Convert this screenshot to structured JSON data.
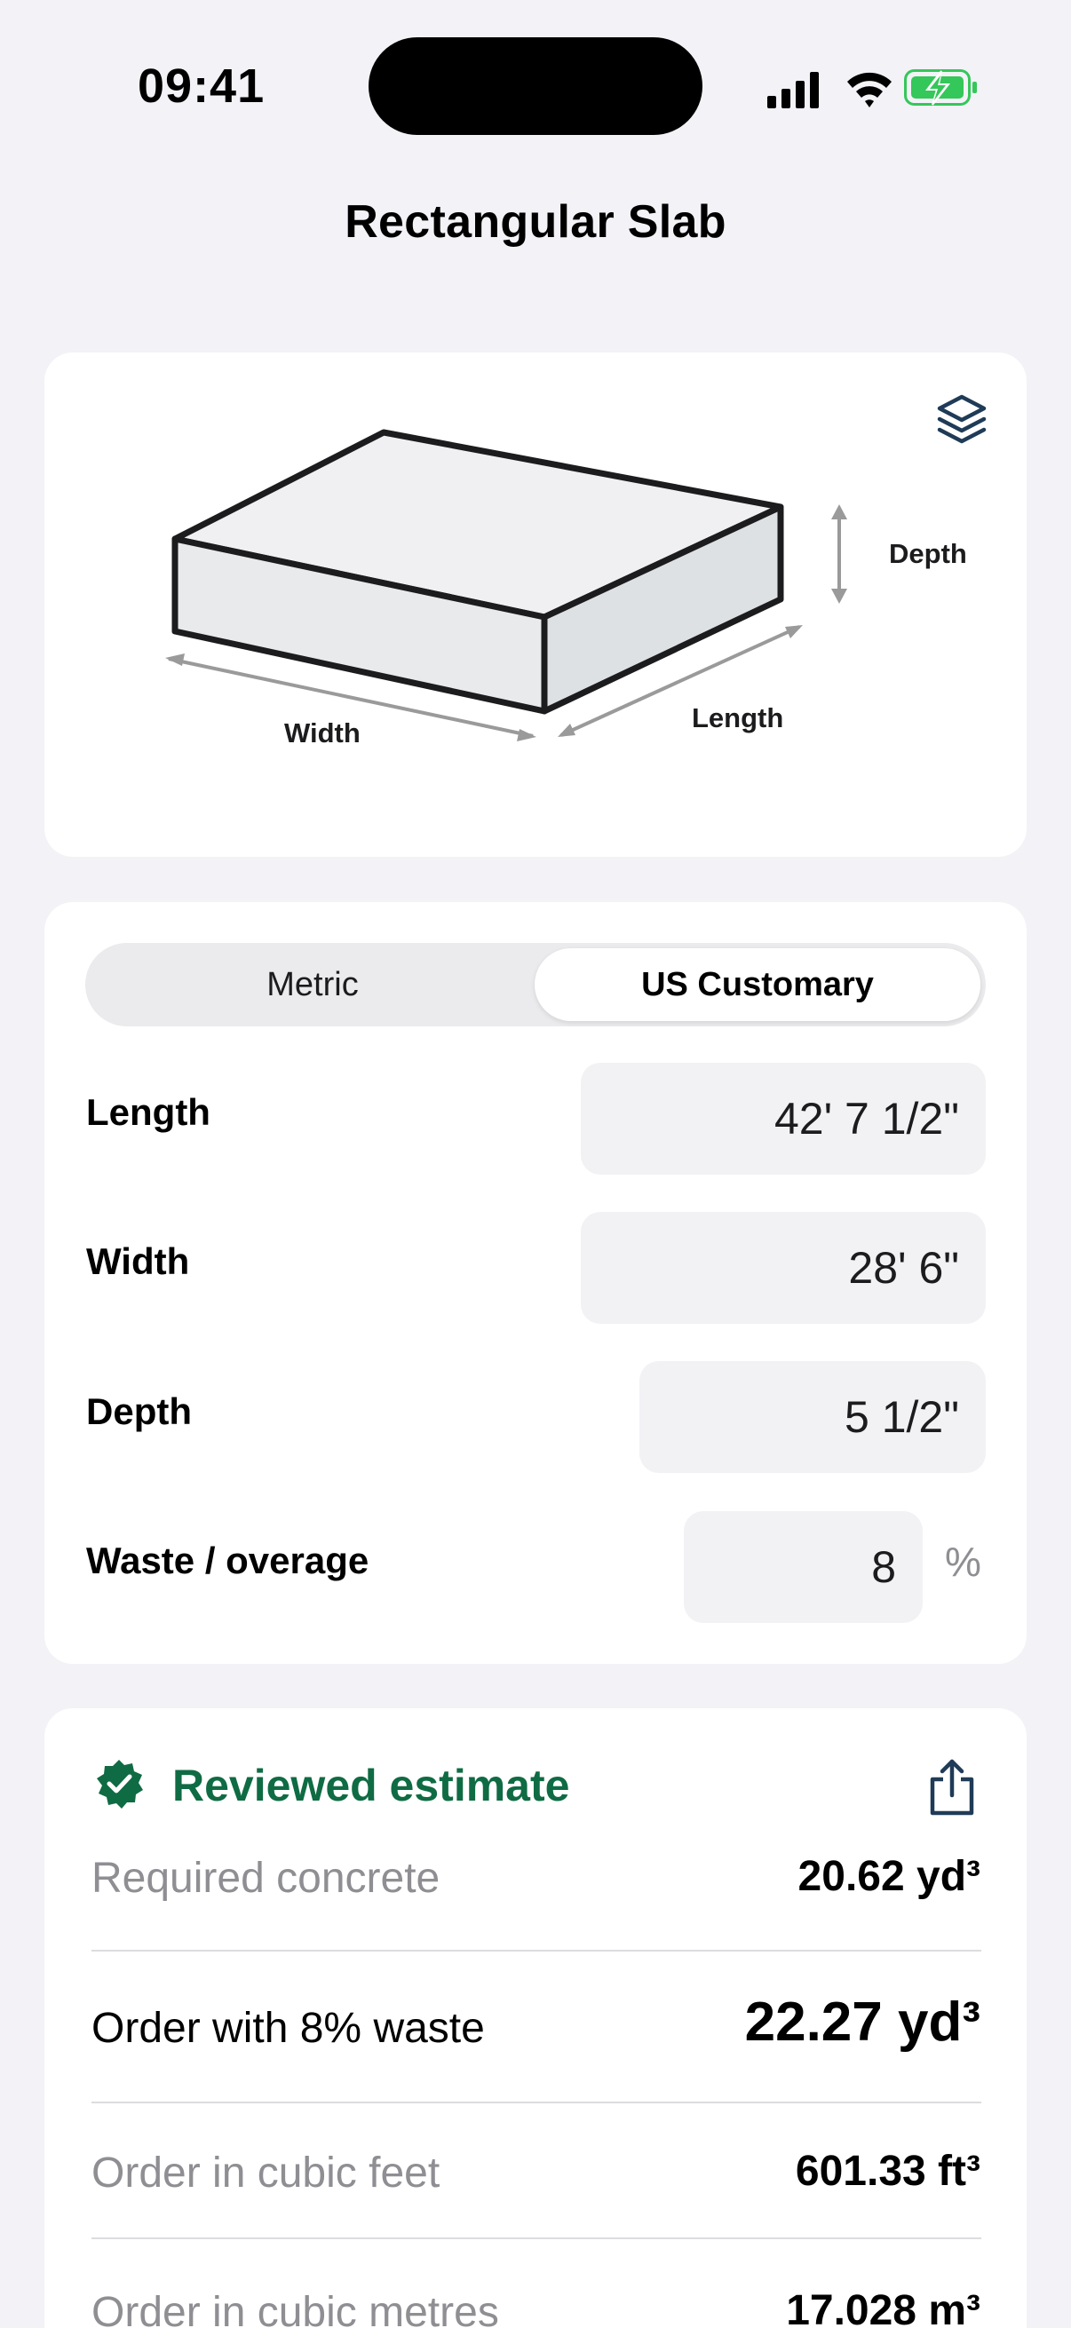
{
  "status_bar": {
    "time": "09:41",
    "icons": [
      "signal-icon",
      "wifi-icon",
      "battery-charging-icon"
    ],
    "battery_color": "#34c759"
  },
  "title": "Rectangular Slab",
  "diagram": {
    "labels": {
      "depth": "Depth",
      "width": "Width",
      "length": "Length"
    },
    "icon": "layers-icon"
  },
  "units": {
    "options": [
      "Metric",
      "US Customary"
    ],
    "selected": "US Customary"
  },
  "fields": {
    "length": {
      "label": "Length",
      "value": "42' 7 1/2\""
    },
    "width": {
      "label": "Width",
      "value": "28' 6\""
    },
    "depth": {
      "label": "Depth",
      "value": "5 1/2\""
    },
    "waste": {
      "label": "Waste / overage",
      "value": "8",
      "unit": "%"
    }
  },
  "result": {
    "badge": "Reviewed estimate",
    "accent": "#0f6b43",
    "share_icon": "share-icon",
    "rows": [
      {
        "label": "Required concrete",
        "value": "20.62 yd³"
      },
      {
        "label": "Order with 8% waste",
        "value": "22.27 yd³"
      },
      {
        "label": "Order in cubic feet",
        "value": "601.33 ft³"
      },
      {
        "label": "Order in cubic metres",
        "value": "17.028 m³"
      }
    ]
  }
}
